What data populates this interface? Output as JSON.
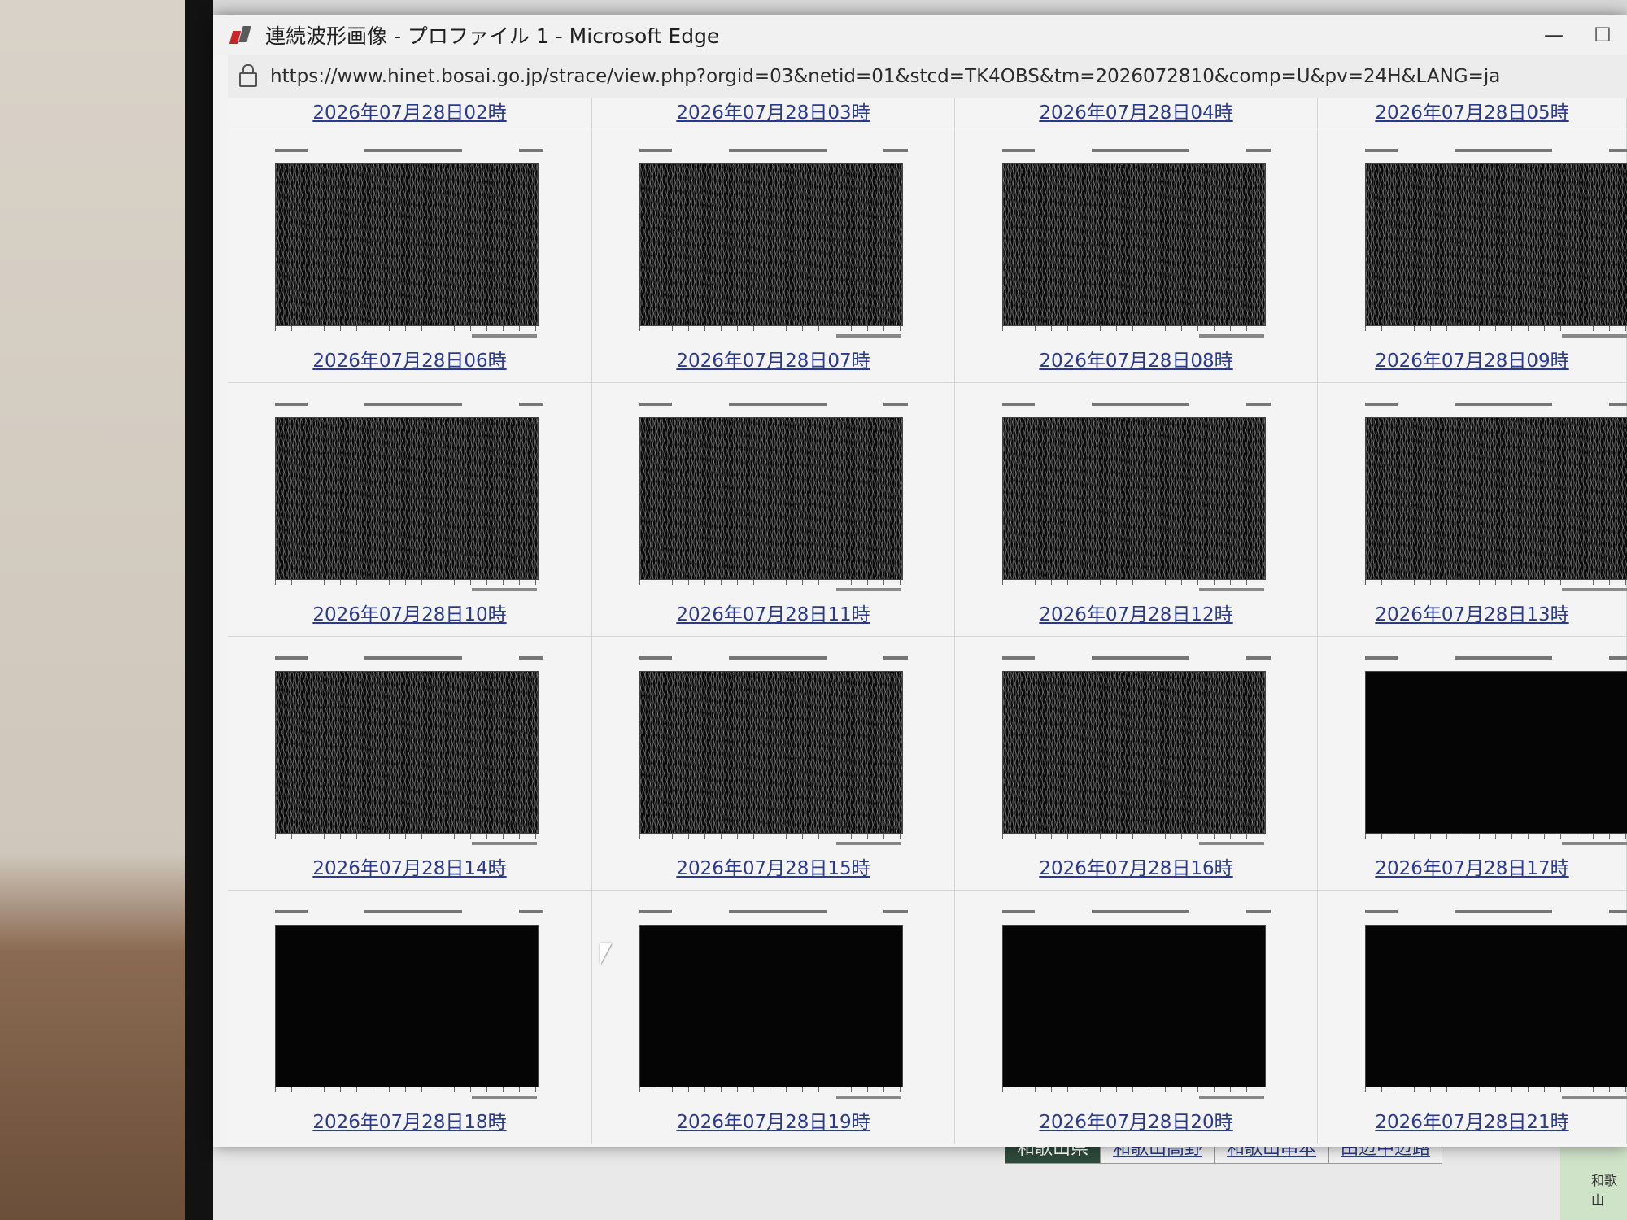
{
  "window": {
    "title": "連続波形画像 - プロファイル 1 - Microsoft Edge",
    "url": "https://www.hinet.bosai.go.jp/strace/view.php?orgid=03&netid=01&stcd=TK4OBS&tm=2026072810&comp=U&pv=24H&LANG=ja",
    "minimize_glyph": "—",
    "maximize_glyph": "☐"
  },
  "top_links": [
    "2026年07月28日02時",
    "2026年07月28日03時",
    "2026年07月28日04時",
    "2026年07月28日05時"
  ],
  "plots": [
    {
      "label": "2026年07月28日06時",
      "waveform": "noise"
    },
    {
      "label": "2026年07月28日07時",
      "waveform": "noise"
    },
    {
      "label": "2026年07月28日08時",
      "waveform": "noise"
    },
    {
      "label": "2026年07月28日09時",
      "waveform": "noise"
    },
    {
      "label": "2026年07月28日10時",
      "waveform": "noise"
    },
    {
      "label": "2026年07月28日11時",
      "waveform": "noise"
    },
    {
      "label": "2026年07月28日12時",
      "waveform": "noise"
    },
    {
      "label": "2026年07月28日13時",
      "waveform": "noise"
    },
    {
      "label": "2026年07月28日14時",
      "waveform": "noise"
    },
    {
      "label": "2026年07月28日15時",
      "waveform": "noise"
    },
    {
      "label": "2026年07月28日16時",
      "waveform": "noise"
    },
    {
      "label": "2026年07月28日17時",
      "waveform": "saturated"
    },
    {
      "label": "2026年07月28日18時",
      "waveform": "saturated"
    },
    {
      "label": "2026年07月28日19時",
      "waveform": "saturated"
    },
    {
      "label": "2026年07月28日20時",
      "waveform": "saturated"
    },
    {
      "label": "2026年07月28日21時",
      "waveform": "saturated"
    }
  ],
  "background_page": {
    "tabs": [
      "和歌山県",
      "和歌山高野",
      "和歌山串本",
      "田辺中辺路"
    ],
    "map_label": "和歌山"
  }
}
